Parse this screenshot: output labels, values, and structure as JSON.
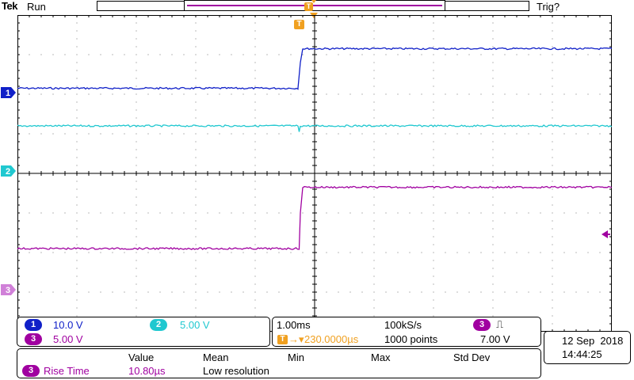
{
  "header": {
    "brand": "Tek",
    "run_state": "Run",
    "trigger_status": "Trig?"
  },
  "markers": {
    "trigger": "T",
    "ch1": "1",
    "ch2": "2",
    "ch3": "3"
  },
  "channels": [
    {
      "number": "1",
      "scale": "10.0 V",
      "color": "#1020c8"
    },
    {
      "number": "2",
      "scale": "5.00 V",
      "color": "#20c8d0"
    },
    {
      "number": "3",
      "scale": "5.00 V",
      "color": "#a000a0"
    }
  ],
  "timebase": {
    "scale": "1.00ms",
    "sample_rate": "100kS/s",
    "trigger_delay": "230.0000µs",
    "record_length": "1000 points",
    "trigger_source": "3",
    "trigger_slope_icon": "rising-edge-icon",
    "trigger_slope_glyph": "⎍",
    "trigger_level": "7.00 V"
  },
  "datetime": {
    "date": "12 Sep  2018",
    "time": "14:44:25"
  },
  "measurement": {
    "headers": [
      "Value",
      "Mean",
      "Min",
      "Max",
      "Std Dev"
    ],
    "source": "3",
    "name": "Rise Time",
    "value": "10.80µs",
    "note": "Low resolution"
  },
  "colors": {
    "ch1": "#1020c8",
    "ch2": "#20c8d0",
    "ch3": "#a000a0",
    "trigger": "#f0a020"
  },
  "chart_data": {
    "type": "line",
    "grid": true,
    "x_divisions": 10,
    "y_divisions": 8,
    "ylim": [
      0,
      8
    ],
    "xlim": [
      0,
      10
    ],
    "series": [
      {
        "name": "1",
        "color": "#1020c8",
        "x": [
          0,
          4.72,
          4.76,
          4.8,
          10
        ],
        "y": [
          6.15,
          6.15,
          6.8,
          7.15,
          7.15
        ]
      },
      {
        "name": "2",
        "color": "#20c8d0",
        "x": [
          0,
          4.72,
          4.74,
          4.76,
          10
        ],
        "y": [
          5.2,
          5.2,
          5.05,
          5.2,
          5.2
        ]
      },
      {
        "name": "3",
        "color": "#a000a0",
        "x": [
          0,
          4.74,
          4.76,
          4.8,
          10
        ],
        "y": [
          2.1,
          2.1,
          3.0,
          3.65,
          3.65
        ]
      }
    ]
  }
}
